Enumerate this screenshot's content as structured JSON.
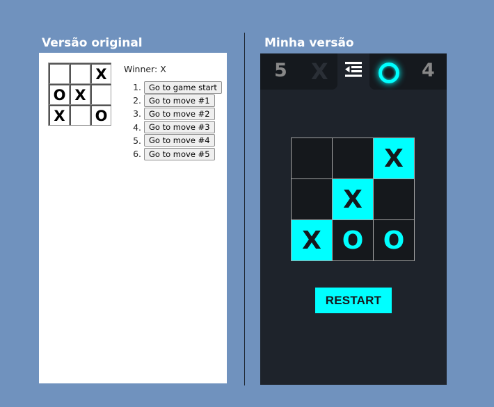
{
  "headings": {
    "original": "Versão original",
    "mine": "Minha versão"
  },
  "original": {
    "board": [
      "",
      "",
      "X",
      "O",
      "X",
      "",
      "X",
      "",
      "O"
    ],
    "status": "Winner: X",
    "moves": [
      {
        "num": "1.",
        "label": "Go to game start"
      },
      {
        "num": "2.",
        "label": "Go to move #1"
      },
      {
        "num": "3.",
        "label": "Go to move #2"
      },
      {
        "num": "4.",
        "label": "Go to move #3"
      },
      {
        "num": "5.",
        "label": "Go to move #4"
      },
      {
        "num": "6.",
        "label": "Go to move #5"
      }
    ]
  },
  "mine": {
    "score_x": "5",
    "score_x_icon": "X",
    "menu_icon": "menu-collapse-icon",
    "score_o_icon": "ring-o-icon",
    "score_o": "4",
    "board": [
      "",
      "",
      "X",
      "",
      "X",
      "",
      "X",
      "O",
      "O"
    ],
    "winning_cells": [
      2,
      4,
      6
    ],
    "restart_label": "RESTART"
  },
  "colors": {
    "page_bg": "#7092be",
    "accent": "#00ffff",
    "panel_dark": "#1e232b",
    "cell_dark": "#15181c"
  }
}
